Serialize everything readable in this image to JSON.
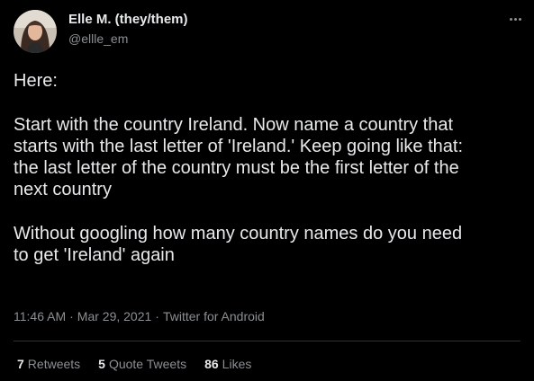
{
  "author": {
    "display_name": "Elle M. (they/them)",
    "handle": "@ellle_em"
  },
  "tweet": {
    "text": "Here:\n\nStart with the country Ireland. Now name a country that\nstarts with the last letter of 'Ireland.' Keep going like that:\nthe last letter of the country must be the first letter of the\nnext country\n\nWithout googling how many country names do you need\nto get 'Ireland' again",
    "time": "11:46 AM",
    "date": "Mar 29, 2021",
    "separator": "·",
    "source": "Twitter for Android"
  },
  "stats": {
    "retweets_count": "7",
    "retweets_label": "Retweets",
    "quotes_count": "5",
    "quotes_label": "Quote Tweets",
    "likes_count": "86",
    "likes_label": "Likes"
  },
  "icons": {
    "more": "more-options-icon"
  },
  "colors": {
    "background": "#000000",
    "primary_text": "#e7e9ea",
    "secondary_text": "#8b8f94",
    "divider": "#2f3336"
  }
}
